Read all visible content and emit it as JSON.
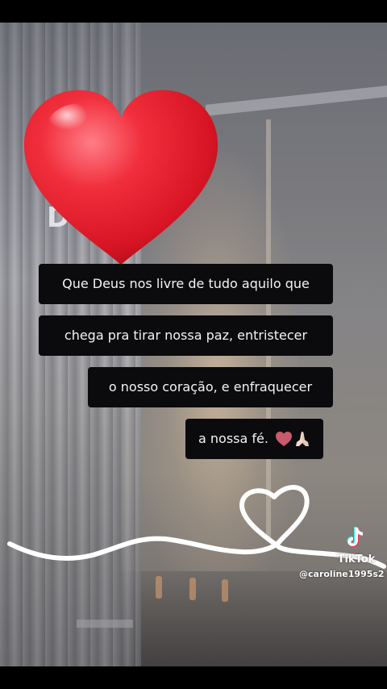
{
  "captions": [
    "Que Deus nos livre de tudo aquilo que",
    "chega pra tirar nossa paz, entristecer",
    "o nosso coração, e enfraquecer",
    "a nossa fé."
  ],
  "background_word": "D        !",
  "watermark": {
    "brand": "TikTok",
    "handle": "@caroline1995s2"
  },
  "icons": {
    "big_heart": "red-heart-emoji",
    "caption_emojis": [
      "heart-emoji",
      "praying-hands-emoji"
    ],
    "doodle": "white-heart-scribble",
    "logo": "tiktok-note-logo"
  },
  "colors": {
    "caption_bg": "#0b0b0d",
    "caption_text": "#f4f4f4",
    "heart_red": "#e5202f",
    "heart_emoji": "#c85a6e"
  }
}
